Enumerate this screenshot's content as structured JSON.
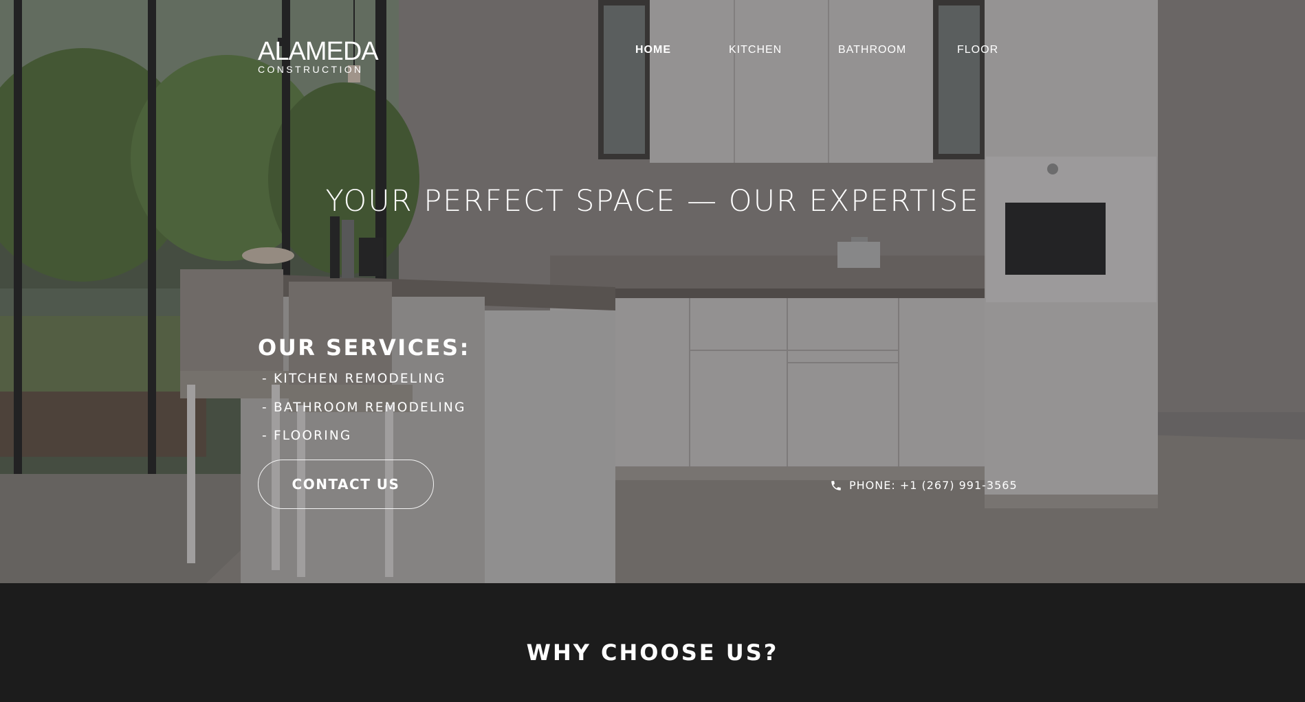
{
  "logo": {
    "main": "ALAMEDA",
    "sub": "CONSTRUCTION"
  },
  "nav": [
    {
      "label": "HOME",
      "active": true
    },
    {
      "label": "KITCHEN",
      "active": false
    },
    {
      "label": "BATHROOM",
      "active": false
    },
    {
      "label": "FLOOR",
      "active": false
    }
  ],
  "hero": {
    "headline": "YOUR PERFECT SPACE — OUR EXPERTISE",
    "services_title": "OUR SERVICES:",
    "services": [
      "- KITCHEN REMODELING",
      "- BATHROOM REMODELING",
      "- FLOORING"
    ],
    "contact_label": "CONTACT US",
    "phone": "PHONE: +1 (267) 991-3565",
    "phone_icon": "phone-icon"
  },
  "section": {
    "title": "WHY CHOOSE US?"
  },
  "colors": {
    "dark_bg": "#1c1c1c",
    "text": "#ffffff"
  }
}
